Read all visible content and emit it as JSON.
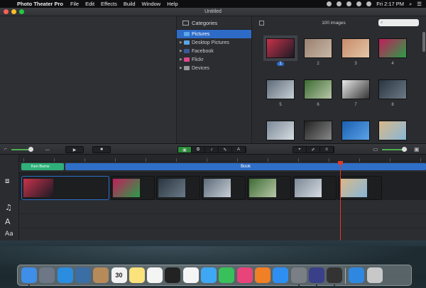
{
  "menubar": {
    "app_name": "Photo Theater Pro",
    "items": [
      "File",
      "Edit",
      "Effects",
      "Build",
      "Window",
      "Help"
    ],
    "clock": "Fri 2:17 PM"
  },
  "window": {
    "title": "Untitled"
  },
  "categories": {
    "header": "Categories",
    "items": [
      {
        "label": "Pictures",
        "selected": true
      },
      {
        "label": "Desktop Pictures",
        "selected": false
      },
      {
        "label": "Facebook",
        "selected": false
      },
      {
        "label": "Flickr",
        "selected": false
      },
      {
        "label": "Devices",
        "selected": false
      }
    ]
  },
  "images": {
    "count_label": "100 images",
    "search_placeholder": "",
    "thumbs": [
      {
        "label": "1",
        "colors": [
          "#c8324a",
          "#1a1a24"
        ],
        "selected": true
      },
      {
        "label": "2",
        "colors": [
          "#9a8070",
          "#c9b9a6"
        ],
        "selected": false
      },
      {
        "label": "3",
        "colors": [
          "#c78a6a",
          "#e3c8a8"
        ],
        "selected": false
      },
      {
        "label": "4",
        "colors": [
          "#c21e5a",
          "#2a9d4a"
        ],
        "selected": false
      },
      {
        "label": "5",
        "colors": [
          "#5c6a78",
          "#c9d0d8"
        ],
        "selected": false
      },
      {
        "label": "6",
        "colors": [
          "#3d6b34",
          "#b8c8a8"
        ],
        "selected": false
      },
      {
        "label": "7",
        "colors": [
          "#e9e9e9",
          "#333333"
        ],
        "selected": false
      },
      {
        "label": "8",
        "colors": [
          "#2a3640",
          "#6b7a88"
        ],
        "selected": false
      },
      {
        "label": "",
        "colors": [
          "#7a8896",
          "#d8dde2"
        ],
        "selected": false
      },
      {
        "label": "",
        "colors": [
          "#222222",
          "#888888"
        ],
        "selected": false
      },
      {
        "label": "",
        "colors": [
          "#1b5fb0",
          "#5aa3e8"
        ],
        "selected": false
      },
      {
        "label": "",
        "colors": [
          "#d8b88a",
          "#87b7d8"
        ],
        "selected": false
      }
    ]
  },
  "timeline": {
    "ken_burns_label": "Ken Burns",
    "book_label": "Book"
  },
  "dock_apps": [
    "Finder",
    "Launchpad",
    "Safari",
    "Preview",
    "Contacts",
    "Calendar",
    "Notes",
    "Reminders",
    "Photo Booth",
    "Photos",
    "Messages",
    "FaceTime",
    "iTunes",
    "iBooks",
    "App Store",
    "System Preferences",
    "Photo Theater",
    "Script Editor",
    "Downloads",
    "Trash"
  ],
  "calendar_day": "30"
}
